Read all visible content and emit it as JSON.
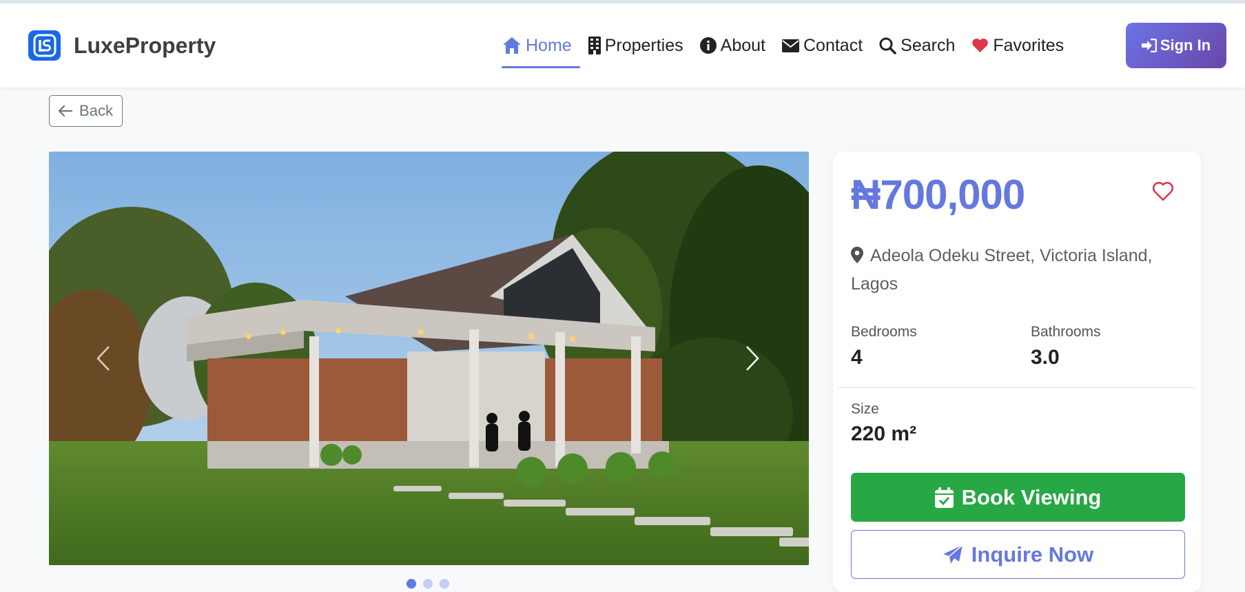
{
  "brand": {
    "name": "LuxeProperty",
    "logo_letters": "LS"
  },
  "nav": {
    "items": [
      {
        "label": "Home",
        "icon": "home-icon",
        "active": true
      },
      {
        "label": "Properties",
        "icon": "building-icon"
      },
      {
        "label": "About",
        "icon": "info-icon"
      },
      {
        "label": "Contact",
        "icon": "envelope-icon"
      },
      {
        "label": "Search",
        "icon": "search-icon"
      },
      {
        "label": "Favorites",
        "icon": "heart-icon"
      }
    ],
    "signin_label": "Sign In"
  },
  "back_label": "Back",
  "gallery": {
    "slide_count": 3,
    "active_slide": 1
  },
  "property": {
    "price": "₦700,000",
    "address": "Adeola Odeku Street, Victoria Island, Lagos",
    "bedrooms_label": "Bedrooms",
    "bedrooms": "4",
    "bathrooms_label": "Bathrooms",
    "bathrooms": "3.0",
    "size_label": "Size",
    "size": "220 m²"
  },
  "actions": {
    "book_label": "Book Viewing",
    "inquire_label": "Inquire Now"
  },
  "colors": {
    "accent": "#6578df",
    "success": "#28a745",
    "favorite": "#e0344a",
    "signin_start": "#6d74e8",
    "signin_end": "#6a46a8"
  }
}
